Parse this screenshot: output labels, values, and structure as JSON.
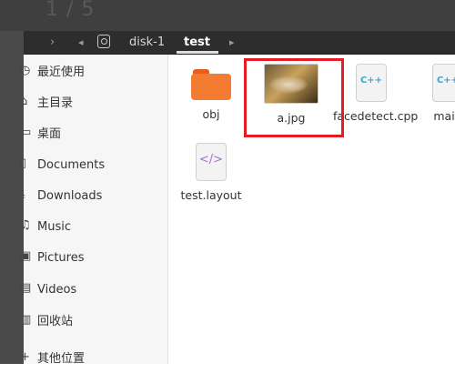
{
  "top_hint": "1 / 5",
  "pathbar": {
    "back_glyph": "‹",
    "forward_glyph": "›",
    "prev_glyph": "◂",
    "next_glyph": "▸",
    "crumbs": [
      "disk-1",
      "test"
    ]
  },
  "sidebar": {
    "items": [
      {
        "label": "最近使用",
        "icon": "clock-icon"
      },
      {
        "label": "主目录",
        "icon": "home-icon"
      },
      {
        "label": "桌面",
        "icon": "desktop-icon"
      },
      {
        "label": "Documents",
        "icon": "document-icon"
      },
      {
        "label": "Downloads",
        "icon": "download-icon"
      },
      {
        "label": "Music",
        "icon": "music-icon"
      },
      {
        "label": "Pictures",
        "icon": "pictures-icon"
      },
      {
        "label": "Videos",
        "icon": "video-icon"
      },
      {
        "label": "回收站",
        "icon": "trash-icon"
      },
      {
        "label": "其他位置",
        "icon": "plus-icon"
      }
    ]
  },
  "files": [
    {
      "name": "obj",
      "kind": "folder"
    },
    {
      "name": "a.jpg",
      "kind": "image"
    },
    {
      "name": "facedetect.cpp",
      "kind": "cpp",
      "mark": "C++"
    },
    {
      "name": "main",
      "kind": "cpp",
      "mark": "C++"
    },
    {
      "name": "test.layout",
      "kind": "xml",
      "mark": "</>"
    }
  ],
  "colors": {
    "highlight": "#e51c23",
    "folder": "#f47b32",
    "sidebar_bg": "#f6f6f6"
  }
}
